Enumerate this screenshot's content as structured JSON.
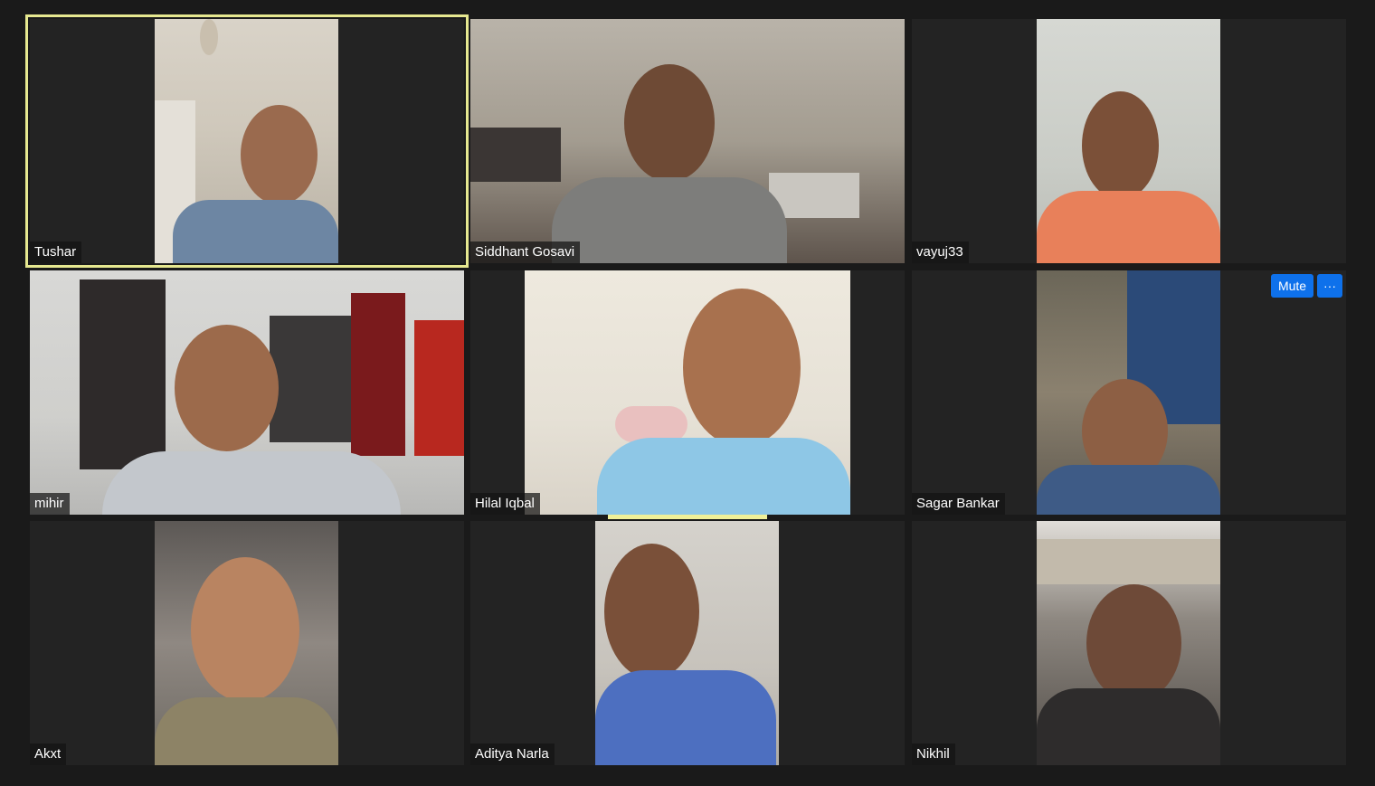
{
  "participants": [
    {
      "name": "Tushar"
    },
    {
      "name": "Siddhant Gosavi"
    },
    {
      "name": "vayuj33"
    },
    {
      "name": "mihir"
    },
    {
      "name": "Hilal Iqbal"
    },
    {
      "name": "Sagar Bankar"
    },
    {
      "name": "Akxt"
    },
    {
      "name": "Aditya Narla"
    },
    {
      "name": "Nikhil"
    }
  ],
  "tile_controls": {
    "mute_label": "Mute",
    "more_label": "···"
  },
  "colors": {
    "background": "#1a1a1a",
    "tile": "#232323",
    "active_speaker_border": "#e6e890",
    "button": "#0e71eb"
  },
  "icons": [
    "more-options-icon"
  ]
}
